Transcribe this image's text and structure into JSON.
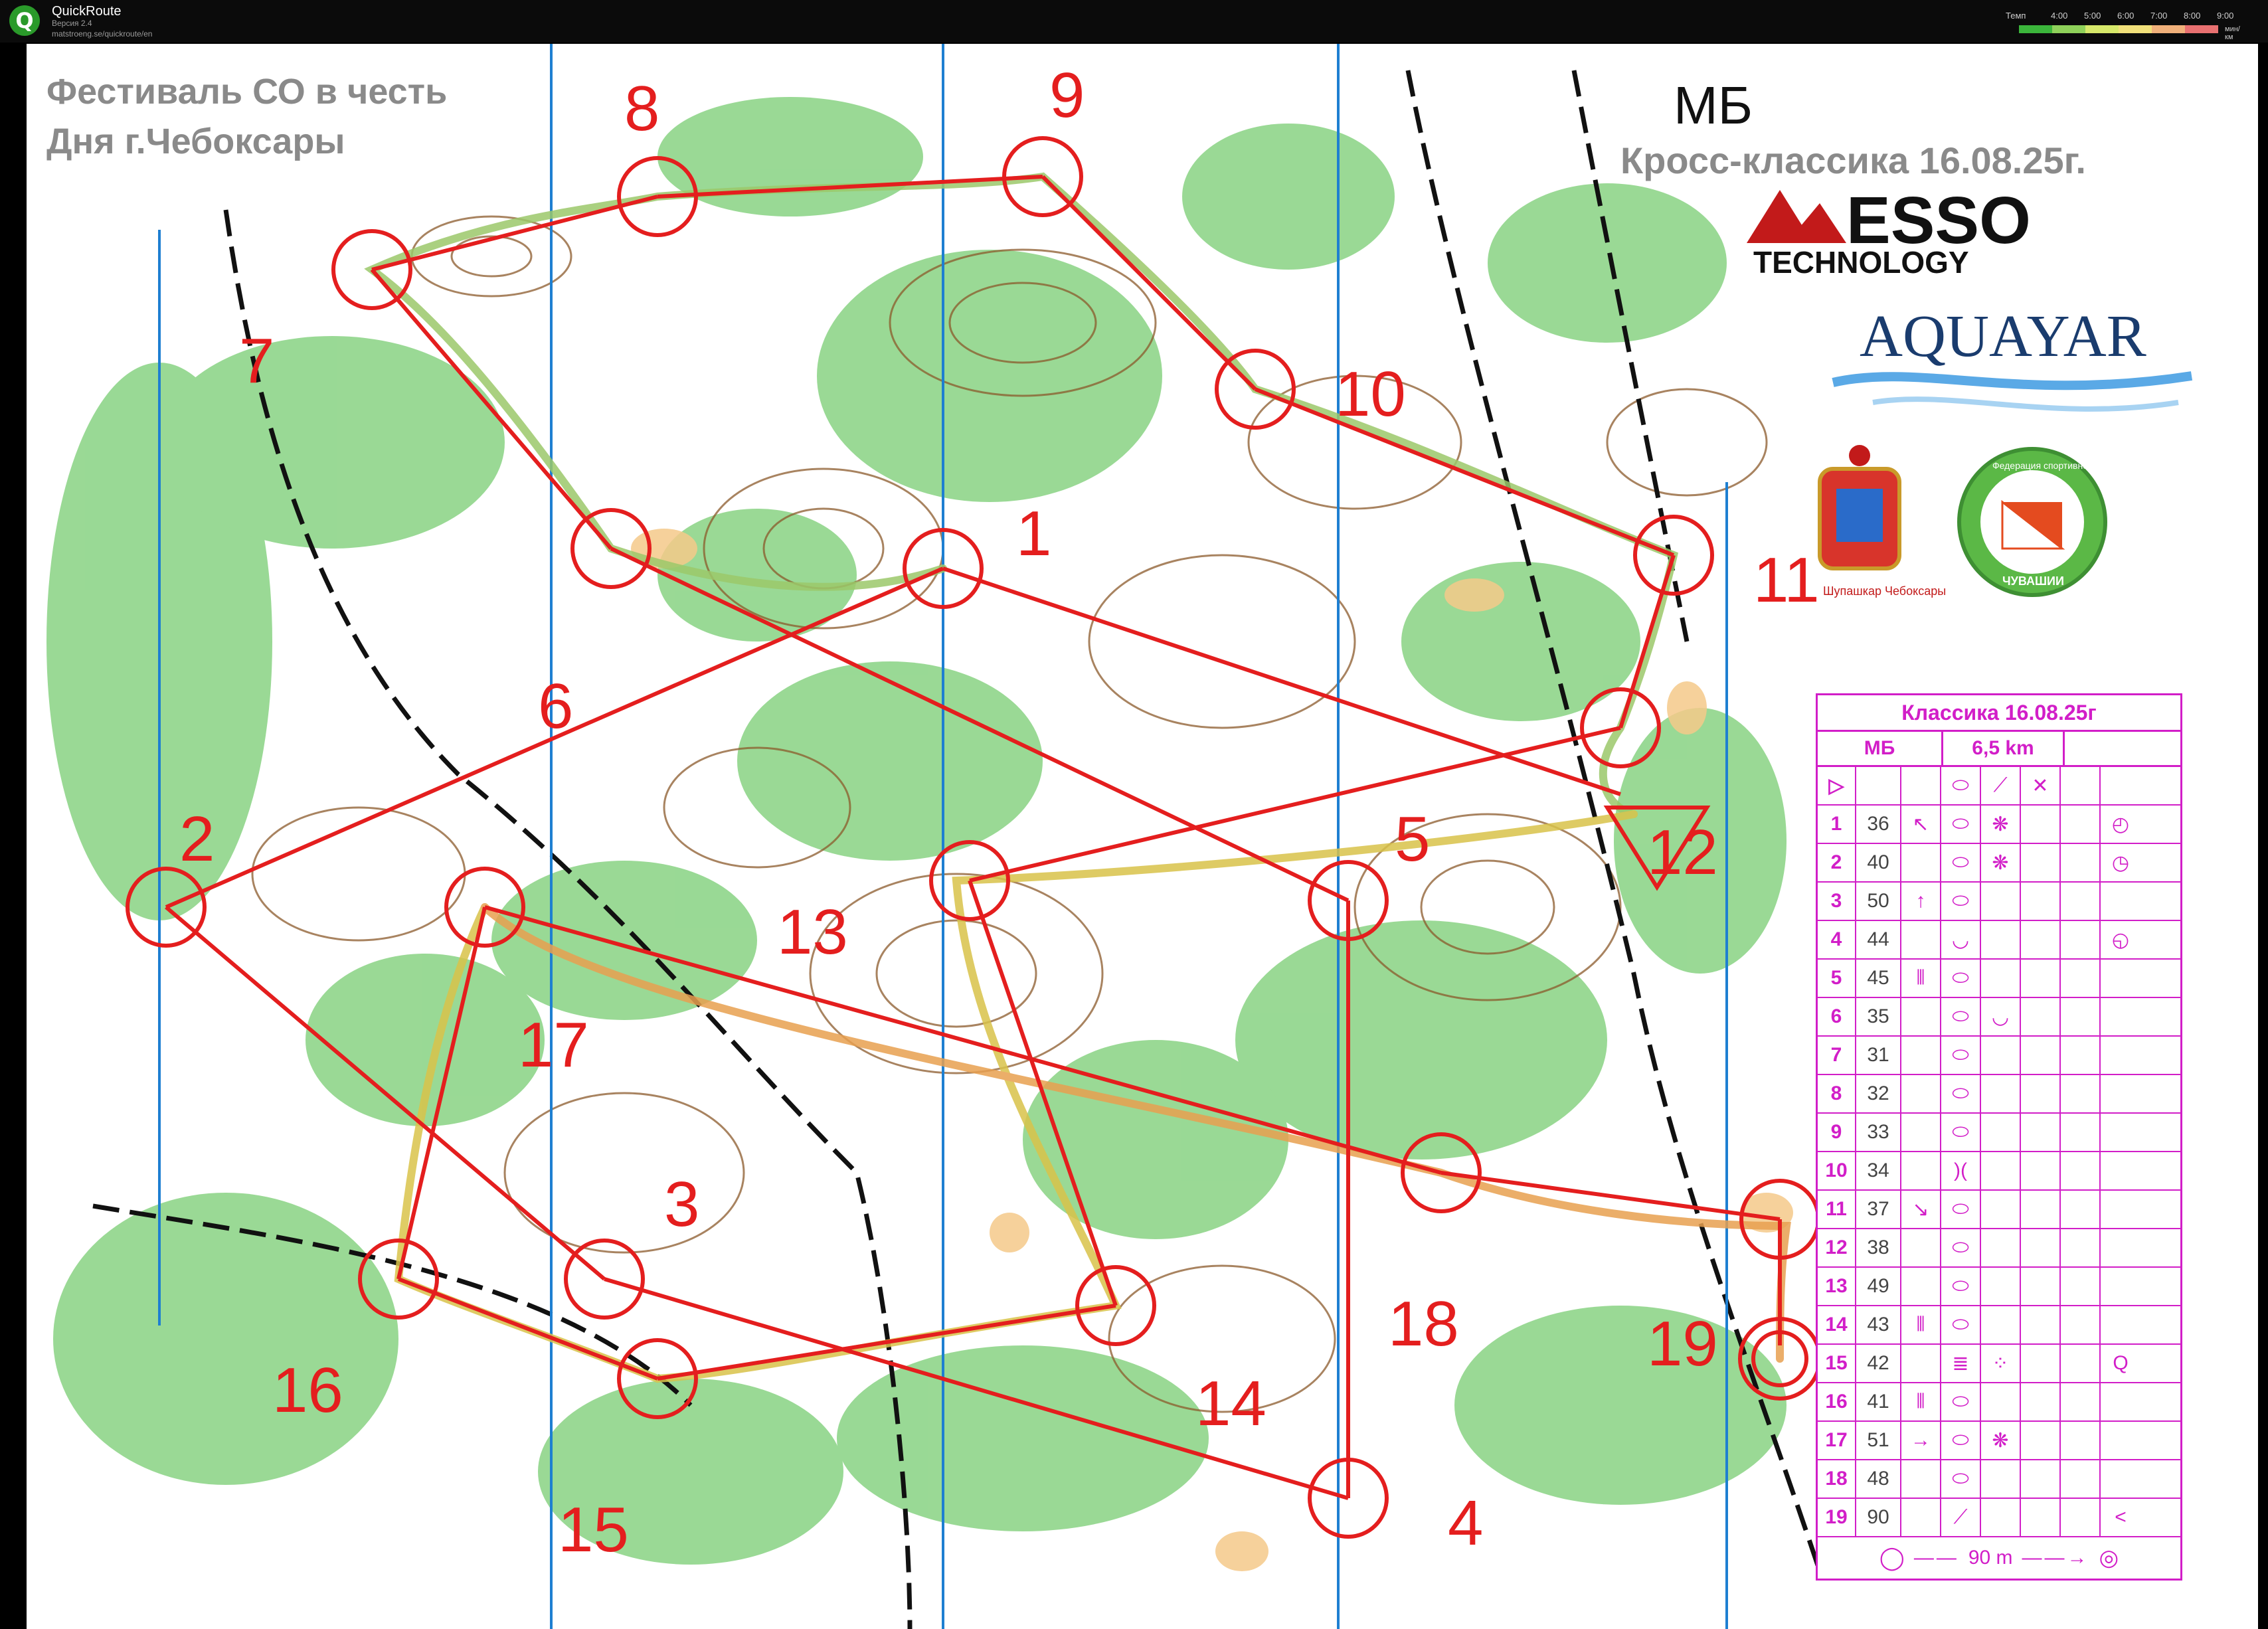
{
  "app": {
    "name": "QuickRoute",
    "version": "Версия 2.4",
    "url": "matstroeng.se/quickroute/en"
  },
  "pace_legend": {
    "label": "Темп",
    "ticks": [
      "4:00",
      "5:00",
      "6:00",
      "7:00",
      "8:00",
      "9:00"
    ],
    "unit": "мин/км",
    "colors": [
      "#3bb53b",
      "#8fd15a",
      "#d6e86a",
      "#f1e07a",
      "#f0b07a",
      "#e87070"
    ]
  },
  "map": {
    "event_title_line1": "Фестиваль СО в честь",
    "event_title_line2": "Дня г.Чебоксары",
    "course_name": "МБ",
    "course_subtitle": "Кросс-классика 16.08.25г.",
    "sponsor1": "ESSO",
    "sponsor1_sub": "TECHNOLOGY",
    "sponsor2": "AQUAYAR",
    "crest_caption": "Шупашкар Чебоксары",
    "federation_caption_top": "Федерация спортивного ориентирования",
    "federation_caption_bottom": "ЧУВАШИИ",
    "controls": [
      {
        "num": "1"
      },
      {
        "num": "2"
      },
      {
        "num": "3"
      },
      {
        "num": "4"
      },
      {
        "num": "5"
      },
      {
        "num": "6"
      },
      {
        "num": "7"
      },
      {
        "num": "8"
      },
      {
        "num": "9"
      },
      {
        "num": "10"
      },
      {
        "num": "11"
      },
      {
        "num": "12"
      },
      {
        "num": "13"
      },
      {
        "num": "14"
      },
      {
        "num": "15"
      },
      {
        "num": "16"
      },
      {
        "num": "17"
      },
      {
        "num": "18"
      },
      {
        "num": "19"
      }
    ],
    "colors": {
      "course": "#e41e1e",
      "forest": "#8fd58a",
      "open": "#f5c98a",
      "contour": "#8b5a2b",
      "north_lines": "#1e7fd1"
    }
  },
  "descriptions": {
    "header": "Классика 16.08.25г",
    "class": "МБ",
    "length": "6,5 km",
    "finish_distance": "90 m",
    "rows": [
      {
        "n": "1",
        "code": "36",
        "dir": "↖",
        "feat": "⬭",
        "det": "❋",
        "extra": "◴"
      },
      {
        "n": "2",
        "code": "40",
        "dir": "",
        "feat": "⬭",
        "det": "❋",
        "extra": "◷"
      },
      {
        "n": "3",
        "code": "50",
        "dir": "↑",
        "feat": "⬭",
        "det": "",
        "extra": ""
      },
      {
        "n": "4",
        "code": "44",
        "dir": "",
        "feat": "◡",
        "det": "",
        "extra": "◵"
      },
      {
        "n": "5",
        "code": "45",
        "dir": "⦀",
        "feat": "⬭",
        "det": "",
        "extra": ""
      },
      {
        "n": "6",
        "code": "35",
        "dir": "",
        "feat": "⬭",
        "det": "◡",
        "extra": ""
      },
      {
        "n": "7",
        "code": "31",
        "dir": "",
        "feat": "⬭",
        "det": "",
        "extra": ""
      },
      {
        "n": "8",
        "code": "32",
        "dir": "",
        "feat": "⬭",
        "det": "",
        "extra": ""
      },
      {
        "n": "9",
        "code": "33",
        "dir": "",
        "feat": "⬭",
        "det": "",
        "extra": ""
      },
      {
        "n": "10",
        "code": "34",
        "dir": "",
        "feat": ")(",
        "det": "",
        "extra": ""
      },
      {
        "n": "11",
        "code": "37",
        "dir": "↘",
        "feat": "⬭",
        "det": "",
        "extra": ""
      },
      {
        "n": "12",
        "code": "38",
        "dir": "",
        "feat": "⬭",
        "det": "",
        "extra": ""
      },
      {
        "n": "13",
        "code": "49",
        "dir": "",
        "feat": "⬭",
        "det": "",
        "extra": ""
      },
      {
        "n": "14",
        "code": "43",
        "dir": "⦀",
        "feat": "⬭",
        "det": "",
        "extra": ""
      },
      {
        "n": "15",
        "code": "42",
        "dir": "",
        "feat": "≣",
        "det": "⁘",
        "extra": "Q"
      },
      {
        "n": "16",
        "code": "41",
        "dir": "⦀",
        "feat": "⬭",
        "det": "",
        "extra": ""
      },
      {
        "n": "17",
        "code": "51",
        "dir": "→",
        "feat": "⬭",
        "det": "❋",
        "extra": ""
      },
      {
        "n": "18",
        "code": "48",
        "dir": "",
        "feat": "⬭",
        "det": "",
        "extra": ""
      },
      {
        "n": "19",
        "code": "90",
        "dir": "",
        "feat": "⟋",
        "det": "",
        "extra": "<"
      }
    ]
  }
}
